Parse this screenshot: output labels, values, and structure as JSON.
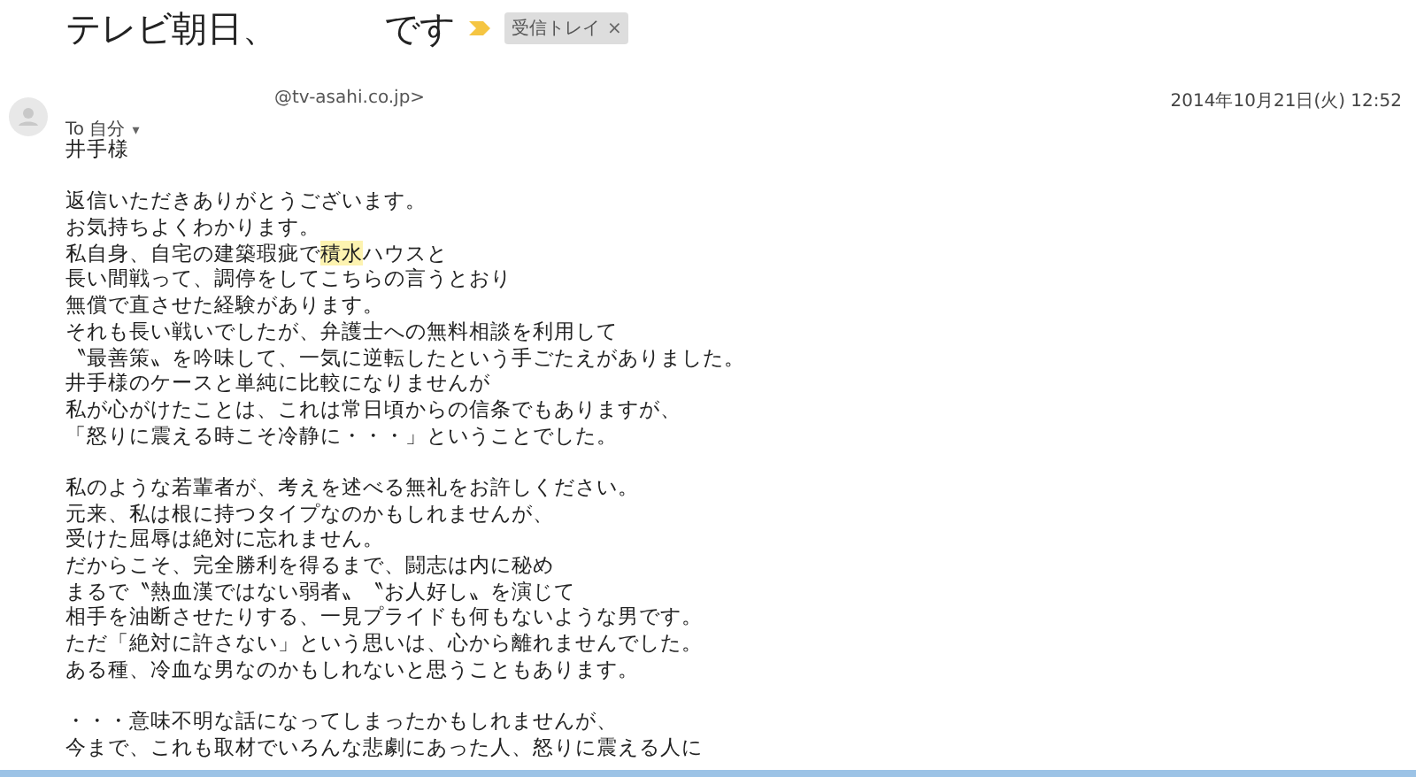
{
  "subject": {
    "title": "テレビ朝日、　　　です",
    "label": "受信トレイ",
    "label_close": "×"
  },
  "sender": {
    "address": "@tv-asahi.co.jp>",
    "date": "2014年10月21日(火) 12:52",
    "recipient": "To 自分",
    "recipient_caret": "▾"
  },
  "paragraphs": [
    [
      [
        {
          "text": "井手様"
        }
      ]
    ],
    [
      [
        {
          "text": "返信いただきありがとうございます。"
        }
      ],
      [
        {
          "text": "お気持ちよくわかります。"
        }
      ],
      [
        {
          "text": "私自身、自宅の建築瑕疵で"
        },
        {
          "text": "積水",
          "highlighted": true
        },
        {
          "text": "ハウスと"
        }
      ],
      [
        {
          "text": "長い間戦って、調停をしてこちらの言うとおり"
        }
      ],
      [
        {
          "text": "無償で直させた経験があります。"
        }
      ],
      [
        {
          "text": "それも長い戦いでしたが、弁護士への無料相談を利用して"
        }
      ],
      [
        {
          "text": "〝最善策〟を吟味して、一気に逆転したという手ごたえがありました。"
        }
      ],
      [
        {
          "text": "井手様のケースと単純に比較になりませんが"
        }
      ],
      [
        {
          "text": "私が心がけたことは、これは常日頃からの信条でもありますが、"
        }
      ],
      [
        {
          "text": "「怒りに震える時こそ冷静に・・・」ということでした。"
        }
      ]
    ],
    [
      [
        {
          "text": "私のような若輩者が、考えを述べる無礼をお許しください。"
        }
      ],
      [
        {
          "text": "元来、私は根に持つタイプなのかもしれませんが、"
        }
      ],
      [
        {
          "text": "受けた屈辱は絶対に忘れません。"
        }
      ],
      [
        {
          "text": "だからこそ、完全勝利を得るまで、闘志は内に秘め"
        }
      ],
      [
        {
          "text": "まるで〝熱血漢ではない弱者〟〝お人好し〟を演じて"
        }
      ],
      [
        {
          "text": "相手を油断させたりする、一見プライドも何もないような男です。"
        }
      ],
      [
        {
          "text": "ただ「絶対に許さない」という思いは、心から離れませんでした。"
        }
      ],
      [
        {
          "text": "ある種、冷血な男なのかもしれないと思うこともあります。"
        }
      ]
    ],
    [
      [
        {
          "text": "・・・意味不明な話になってしまったかもしれませんが、"
        }
      ],
      [
        {
          "text": "今まで、これも取材でいろんな悲劇にあった人、怒りに震える人に"
        }
      ]
    ]
  ]
}
